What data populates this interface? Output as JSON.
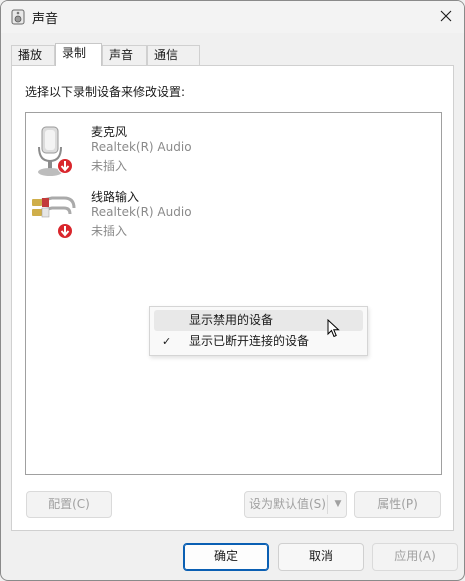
{
  "window": {
    "title": "声音"
  },
  "tabs": [
    {
      "label": "播放"
    },
    {
      "label": "录制"
    },
    {
      "label": "声音"
    },
    {
      "label": "通信"
    }
  ],
  "panel": {
    "instruction": "选择以下录制设备来修改设置:",
    "devices": [
      {
        "name": "麦克风",
        "driver": "Realtek(R) Audio",
        "status": "未插入",
        "icon": "microphone-icon"
      },
      {
        "name": "线路输入",
        "driver": "Realtek(R) Audio",
        "status": "未插入",
        "icon": "line-in-icon"
      }
    ],
    "buttons": {
      "configure": "配置(C)",
      "set_default": "设为默认值(S)",
      "properties": "属性(P)"
    }
  },
  "context_menu": {
    "items": [
      {
        "label": "显示禁用的设备",
        "checked": false
      },
      {
        "label": "显示已断开连接的设备",
        "checked": true
      }
    ],
    "check_mark": "✓"
  },
  "footer": {
    "ok": "确定",
    "cancel": "取消",
    "apply": "应用(A)"
  },
  "colors": {
    "accent": "#0a5fb3",
    "status_red": "#d9262c",
    "disabled_text": "#a0a0a0"
  }
}
